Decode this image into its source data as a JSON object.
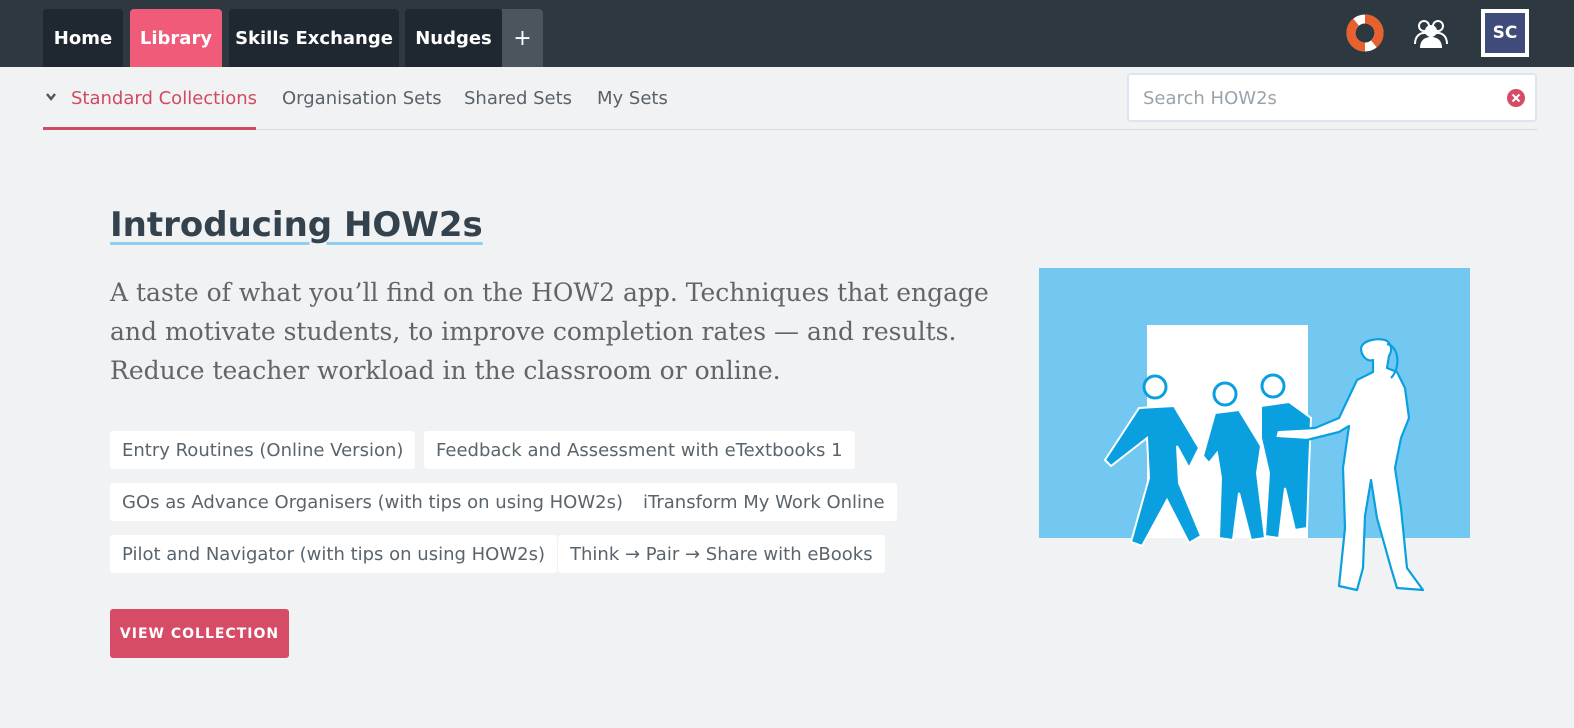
{
  "topnav": {
    "tabs": [
      {
        "label": "Home"
      },
      {
        "label": "Library"
      },
      {
        "label": "Skills Exchange"
      },
      {
        "label": "Nudges"
      },
      {
        "label": "+"
      }
    ],
    "avatar_initials": "SC"
  },
  "subnav": {
    "items": [
      {
        "label": "Standard Collections"
      },
      {
        "label": "Organisation Sets"
      },
      {
        "label": "Shared Sets"
      },
      {
        "label": "My Sets"
      }
    ]
  },
  "search": {
    "placeholder": "Search HOW2s"
  },
  "collection": {
    "title": "Introducing HOW2s",
    "description": "A taste of what you’ll find on the HOW2 app. Techniques that engage and motivate students, to improve completion rates — and results. Reduce teacher workload in the classroom or online.",
    "items": [
      {
        "label": "Entry Routines (Online Version)"
      },
      {
        "label": "Feedback and Assessment with eTextbooks 1"
      },
      {
        "label": "GOs as Advance Organisers (with tips on using HOW2s)"
      },
      {
        "label": "iTransform My Work Online"
      },
      {
        "label": "Pilot and Navigator (with tips on using HOW2s)"
      },
      {
        "label": "Think → Pair → Share with eBooks"
      }
    ],
    "button_label": "VIEW COLLECTION"
  },
  "icons": [
    "lifebuoy-icon",
    "users-icon",
    "chevron-down-icon",
    "clear-icon"
  ],
  "colors": {
    "topbar": "#2d3840",
    "accent": "#ef5b78",
    "button": "#d64c67",
    "illustration_bg": "#72c8f0",
    "figure_blue": "#0aa0e0"
  }
}
